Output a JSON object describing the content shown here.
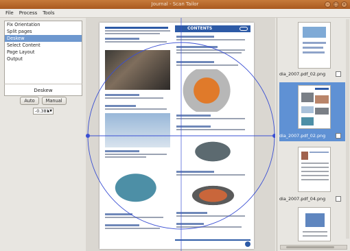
{
  "window": {
    "title": "Journal - Scan Tailor"
  },
  "menu": [
    "File",
    "Process",
    "Tools"
  ],
  "filters": [
    "Fix Orientation",
    "Split pages",
    "Deskew",
    "Select Content",
    "Page Layout",
    "Output"
  ],
  "selected_filter_index": 2,
  "deskew": {
    "label": "Deskew",
    "auto_label": "Auto",
    "manual_label": "Manual",
    "angle_value": "-0.38°"
  },
  "page_header": "CONTENTS",
  "thumbnails": [
    {
      "caption": "dia_2007.pdf_02.png",
      "selected": false
    },
    {
      "caption": "dia_2007.pdf_02.png",
      "selected": true
    },
    {
      "caption": "dia_2007.pdf_04.png",
      "selected": false
    }
  ],
  "colors": {
    "titlebar": "#b8652a",
    "selection": "#6e98cf",
    "accent": "#2d5aa6",
    "guide": "#3a4fd3"
  }
}
